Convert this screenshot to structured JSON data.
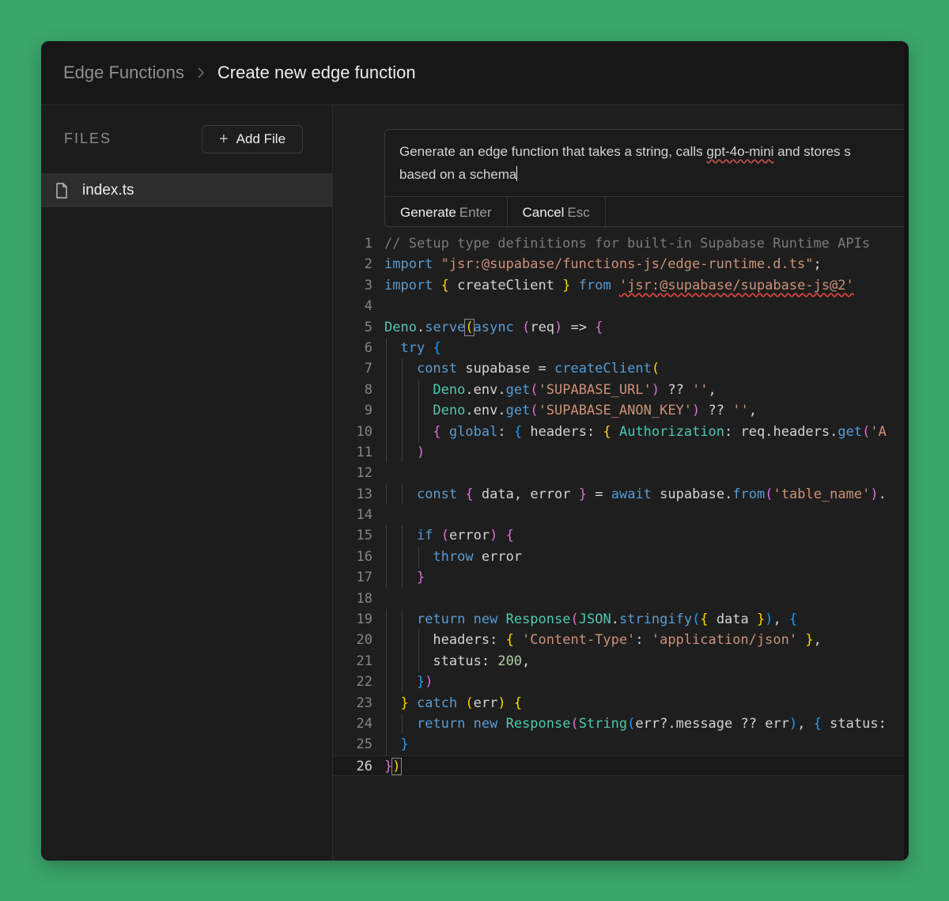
{
  "breadcrumb": {
    "root": "Edge Functions",
    "current": "Create new edge function"
  },
  "sidebar": {
    "files_label": "FILES",
    "add_file_label": "Add File",
    "files": [
      {
        "name": "index.ts",
        "icon": "file-icon"
      }
    ]
  },
  "prompt": {
    "text_line1_a": "Generate an edge function that takes a string, calls ",
    "text_line1_b": "gpt-4o-mini",
    "text_line1_c": " and stores s",
    "text_line2": "based on a schema",
    "generate_label": "Generate",
    "generate_key": "Enter",
    "cancel_label": "Cancel",
    "cancel_key": "Esc"
  },
  "code": {
    "line_numbers": [
      "1",
      "2",
      "3",
      "4",
      "5",
      "6",
      "7",
      "8",
      "9",
      "10",
      "11",
      "12",
      "13",
      "14",
      "15",
      "16",
      "17",
      "18",
      "19",
      "20",
      "21",
      "22",
      "23",
      "24",
      "25",
      "26"
    ],
    "lines": [
      "// Setup type definitions for built-in Supabase Runtime APIs",
      "import \"jsr:@supabase/functions-js/edge-runtime.d.ts\";",
      "import { createClient } from 'jsr:@supabase/supabase-js@2'",
      "",
      "Deno.serve(async (req) => {",
      "  try {",
      "    const supabase = createClient(",
      "      Deno.env.get('SUPABASE_URL') ?? '',",
      "      Deno.env.get('SUPABASE_ANON_KEY') ?? '',",
      "      { global: { headers: { Authorization: req.headers.get('A",
      "    )",
      "",
      "    const { data, error } = await supabase.from('table_name').",
      "",
      "    if (error) {",
      "      throw error",
      "    }",
      "",
      "    return new Response(JSON.stringify({ data }), {",
      "      headers: { 'Content-Type': 'application/json' },",
      "      status: 200,",
      "    })",
      "  } catch (err) {",
      "    return new Response(String(err?.message ?? err), { status:",
      "  }",
      "})"
    ]
  },
  "colors": {
    "background": "#3aa66a",
    "window": "#1c1c1c",
    "keyword": "#569cd6",
    "string": "#ce9178",
    "type": "#4ec9b0",
    "comment": "#7a7a7a"
  }
}
